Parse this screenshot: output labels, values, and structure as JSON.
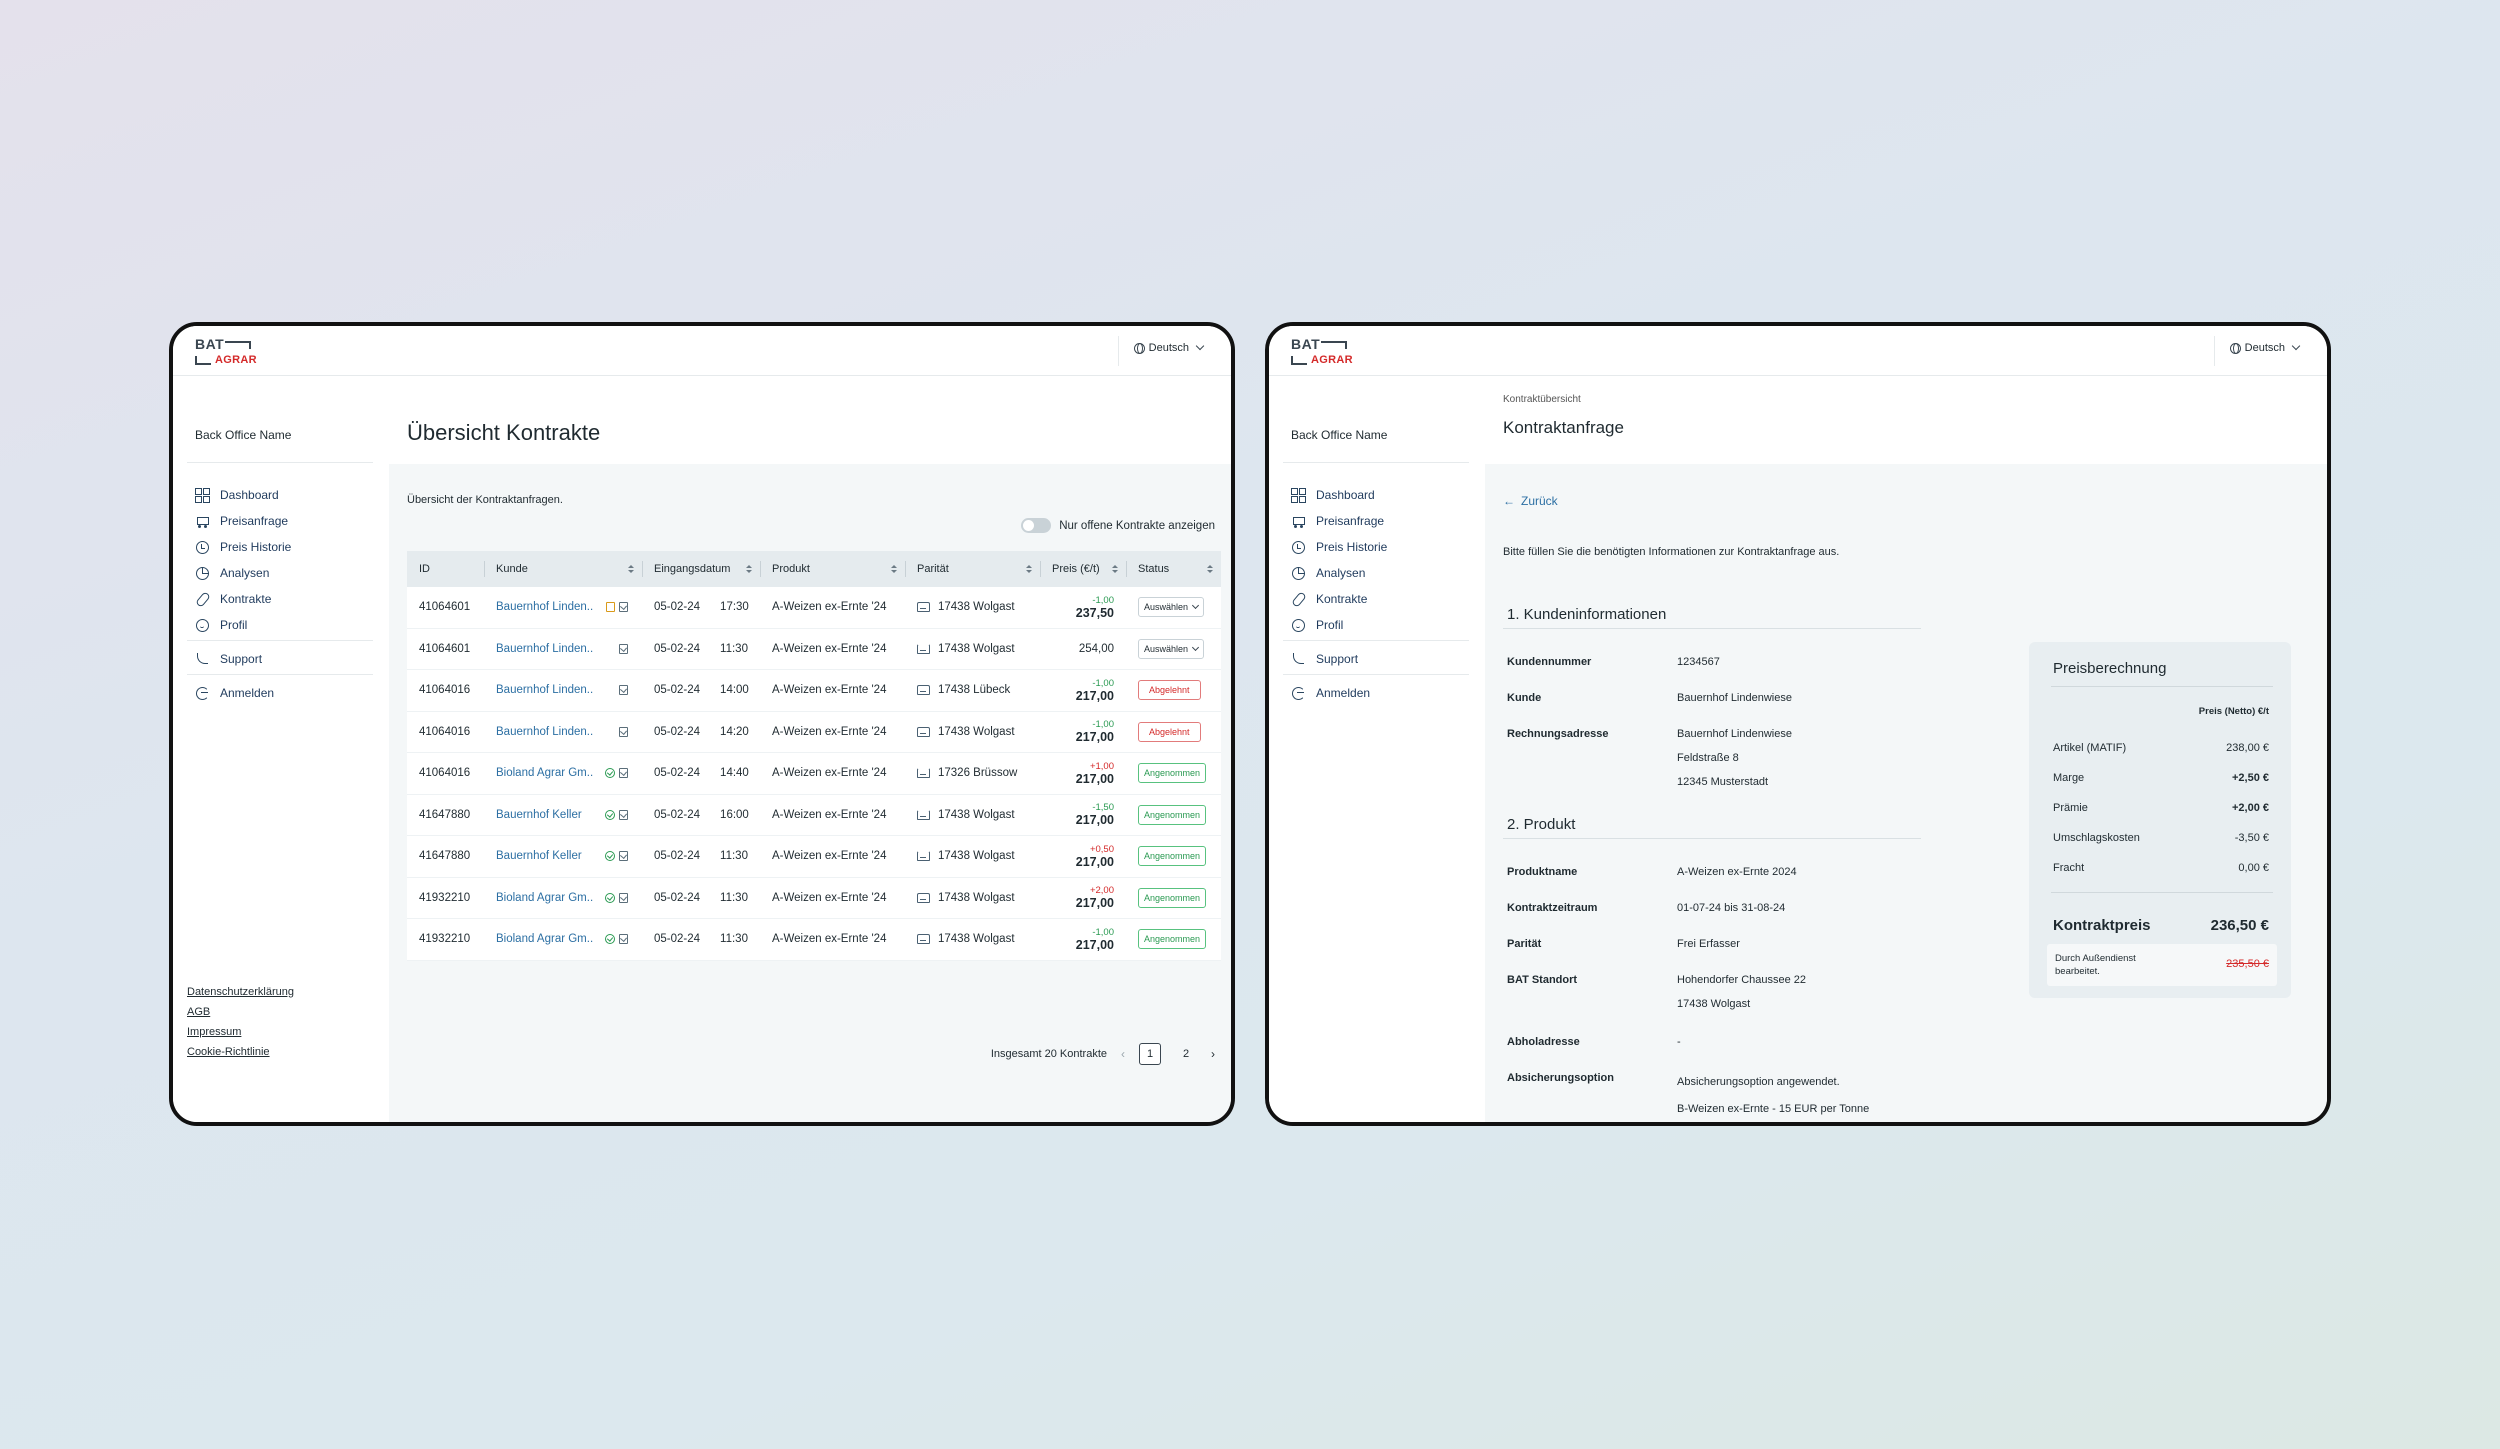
{
  "common": {
    "logo": {
      "bat": "BAT",
      "agrar": "AGRAR"
    },
    "language": "Deutsch",
    "back_office_name": "Back Office Name",
    "nav": [
      {
        "label": "Dashboard",
        "icon": "dashboard-grid-icon"
      },
      {
        "label": "Preisanfrage",
        "icon": "cart-icon"
      },
      {
        "label": "Preis Historie",
        "icon": "history-clock-icon"
      },
      {
        "label": "Analysen",
        "icon": "pie-chart-icon"
      },
      {
        "label": "Kontrakte",
        "icon": "paperclip-icon"
      },
      {
        "label": "Profil",
        "icon": "smiley-icon"
      }
    ],
    "support": "Support",
    "logout": "Anmelden",
    "footer_links": [
      "Datenschutzerklärung",
      "AGB",
      "Impressum",
      "Cookie-Richtlinie"
    ]
  },
  "overview": {
    "title": "Übersicht Kontrakte",
    "intro": "Übersicht der Kontraktanfragen.",
    "toggle_label": "Nur offene Kontrakte anzeigen",
    "columns": [
      "ID",
      "Kunde",
      "Eingangsdatum",
      "Produkt",
      "Parität",
      "Preis (€/t)",
      "Status"
    ],
    "rows": [
      {
        "id": "41064601",
        "kunde": "Bauernhof Linden..",
        "date": "05-02-24",
        "time": "17:30",
        "produkt": "A-Weizen ex-Ernte '24",
        "paritaet": "17438 Wolgast",
        "delta": "-1,00",
        "preis": "237,50",
        "status": "Auswählen"
      },
      {
        "id": "41064601",
        "kunde": "Bauernhof Linden..",
        "date": "05-02-24",
        "time": "11:30",
        "produkt": "A-Weizen ex-Ernte '24",
        "paritaet": "17438 Wolgast",
        "delta": "",
        "preis": "254,00",
        "status": "Auswählen"
      },
      {
        "id": "41064016",
        "kunde": "Bauernhof Linden..",
        "date": "05-02-24",
        "time": "14:00",
        "produkt": "A-Weizen ex-Ernte '24",
        "paritaet": "17438 Lübeck",
        "delta": "-1,00",
        "preis": "217,00",
        "status": "Abgelehnt"
      },
      {
        "id": "41064016",
        "kunde": "Bauernhof Linden..",
        "date": "05-02-24",
        "time": "14:20",
        "produkt": "A-Weizen ex-Ernte '24",
        "paritaet": "17438 Wolgast",
        "delta": "-1,00",
        "preis": "217,00",
        "status": "Abgelehnt"
      },
      {
        "id": "41064016",
        "kunde": "Bioland Agrar Gm..",
        "date": "05-02-24",
        "time": "14:40",
        "produkt": "A-Weizen ex-Ernte '24",
        "paritaet": "17326 Brüssow",
        "delta": "+1,00",
        "preis": "217,00",
        "status": "Angenommen"
      },
      {
        "id": "41647880",
        "kunde": "Bauernhof Keller",
        "date": "05-02-24",
        "time": "16:00",
        "produkt": "A-Weizen ex-Ernte '24",
        "paritaet": "17438 Wolgast",
        "delta": "-1,50",
        "preis": "217,00",
        "status": "Angenommen"
      },
      {
        "id": "41647880",
        "kunde": "Bauernhof Keller",
        "date": "05-02-24",
        "time": "11:30",
        "produkt": "A-Weizen ex-Ernte '24",
        "paritaet": "17438 Wolgast",
        "delta": "+0,50",
        "preis": "217,00",
        "status": "Angenommen"
      },
      {
        "id": "41932210",
        "kunde": "Bioland Agrar Gm..",
        "date": "05-02-24",
        "time": "11:30",
        "produkt": "A-Weizen ex-Ernte '24",
        "paritaet": "17438 Wolgast",
        "delta": "+2,00",
        "preis": "217,00",
        "status": "Angenommen"
      },
      {
        "id": "41932210",
        "kunde": "Bioland Agrar Gm..",
        "date": "05-02-24",
        "time": "11:30",
        "produkt": "A-Weizen ex-Ernte '24",
        "paritaet": "17438 Wolgast",
        "delta": "-1,00",
        "preis": "217,00",
        "status": "Angenommen"
      }
    ],
    "pagination": {
      "total": "Insgesamt 20 Kontrakte",
      "pages": [
        "1",
        "2"
      ],
      "current": "1",
      "prev": "‹",
      "next": "›"
    }
  },
  "detail": {
    "breadcrumb": "Kontraktübersicht",
    "title": "Kontraktanfrage",
    "back": "Zurück",
    "intro": "Bitte füllen Sie die benötigten Informationen zur Kontraktanfrage aus.",
    "section1": {
      "title": "1. Kundeninformationen",
      "fields": [
        {
          "label": "Kundennummer",
          "value": "1234567"
        },
        {
          "label": "Kunde",
          "value": "Bauernhof Lindenwiese"
        },
        {
          "label": "Rechnungsadresse",
          "value": "Bauernhof Lindenwiese",
          "value2": "Feldstraße 8",
          "value3": "12345 Musterstadt"
        }
      ]
    },
    "section2": {
      "title": "2. Produkt",
      "fields": [
        {
          "label": "Produktname",
          "value": "A-Weizen ex-Ernte 2024"
        },
        {
          "label": "Kontraktzeitraum",
          "value": "01-07-24 bis 31-08-24"
        },
        {
          "label": "Parität",
          "value": "Frei Erfasser"
        },
        {
          "label": "BAT Standort",
          "value": "Hohendorfer Chaussee 22",
          "value2": "17438 Wolgast"
        },
        {
          "label": "Abholadresse",
          "value": "-"
        },
        {
          "label": "Absicherungsoption",
          "value": "Absicherungsoption angewendet.",
          "value2": "B-Weizen ex-Ernte - 15 EUR per Tonne"
        }
      ]
    },
    "price_card": {
      "title": "Preisberechnung",
      "column_header": "Preis (Netto) €/t",
      "rows": [
        {
          "label": "Artikel (MATIF)",
          "value": "238,00 €"
        },
        {
          "label": "Marge",
          "value": "+2,50 €"
        },
        {
          "label": "Prämie",
          "value": "+2,00 €"
        },
        {
          "label": "Umschlagskosten",
          "value": "-3,50 €"
        },
        {
          "label": "Fracht",
          "value": "0,00 €"
        }
      ],
      "total_label": "Kontraktpreis",
      "total_value": "236,50 €",
      "note": "Durch Außendienst bearbeitet.",
      "old_price": "235,50 €"
    }
  }
}
